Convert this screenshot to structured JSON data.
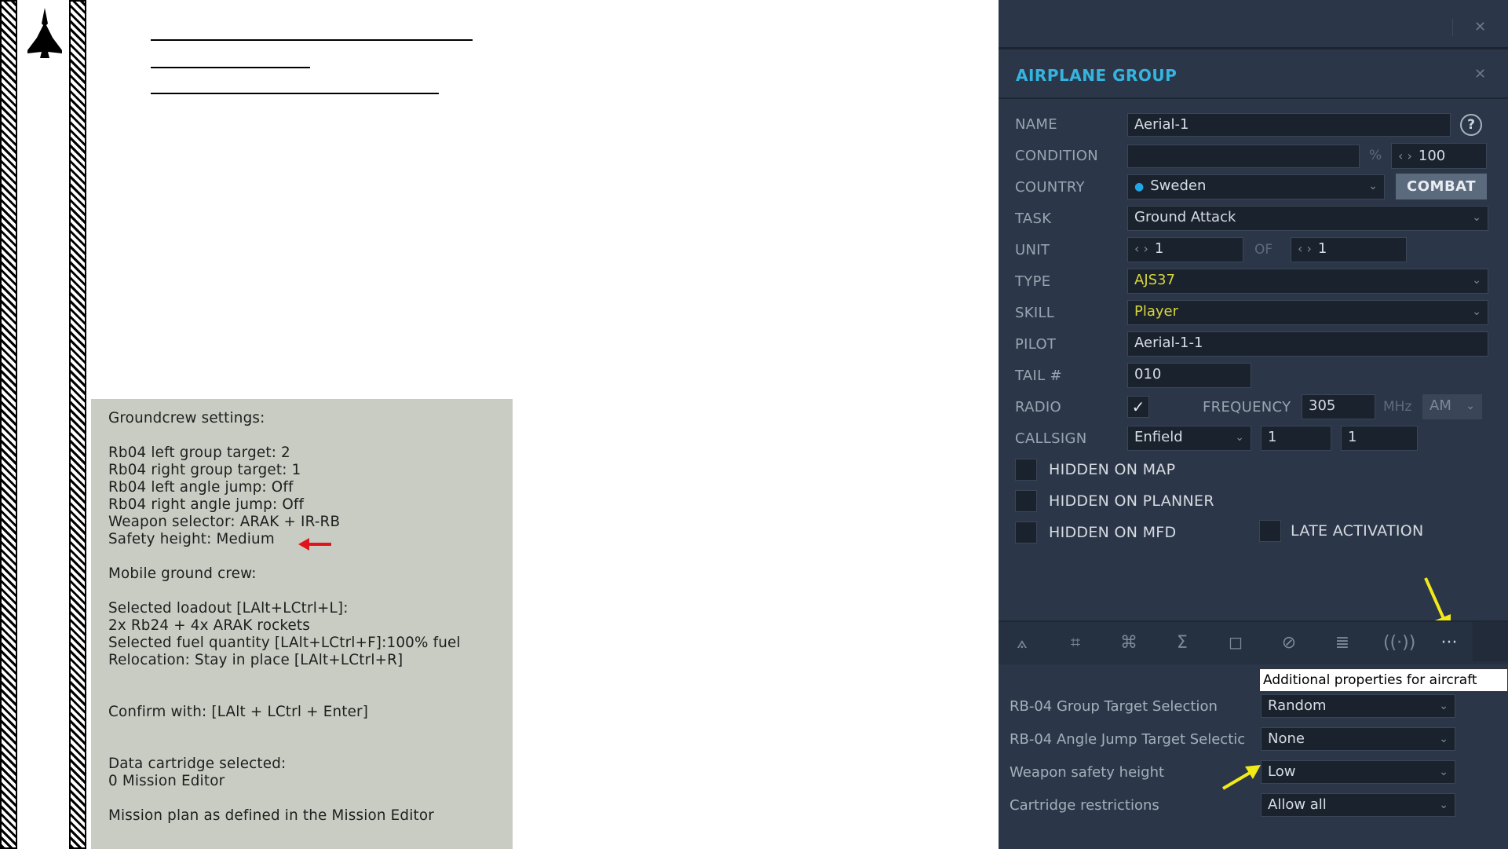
{
  "notes": {
    "lines": [
      "Groundcrew settings:",
      "",
      "Rb04 left group target: 2",
      "Rb04 right group target: 1",
      "Rb04 left angle jump: Off",
      "Rb04 right angle jump: Off",
      "Weapon selector: ARAK + IR-RB",
      "Safety height: Medium",
      "",
      "Mobile ground crew:",
      "",
      "Selected loadout [LAlt+LCtrl+L]:",
      "2x Rb24 + 4x ARAK rockets",
      "Selected fuel quantity [LAlt+LCtrl+F]:100% fuel",
      "Relocation: Stay in place [LAlt+LCtrl+R]",
      "",
      "",
      "Confirm with: [LAlt + LCtrl + Enter]",
      "",
      "",
      "Data cartridge selected:",
      "0 Mission Editor",
      "",
      "Mission plan as defined in the Mission Editor"
    ]
  },
  "panel": {
    "title": "AIRPLANE GROUP",
    "labels": {
      "name": "NAME",
      "condition": "CONDITION",
      "country": "COUNTRY",
      "task": "TASK",
      "unit": "UNIT",
      "type": "TYPE",
      "skill": "SKILL",
      "pilot": "PILOT",
      "tail": "TAIL #",
      "radio": "RADIO",
      "frequency": "FREQUENCY",
      "callsign": "CALLSIGN",
      "of": "OF",
      "percent": "%",
      "mhz": "MHz"
    },
    "values": {
      "name": "Aerial-1",
      "condition": "",
      "condition_value": "100",
      "country": "Sweden",
      "task": "Ground Attack",
      "unit": "1",
      "unit_of": "1",
      "type": "AJS37",
      "skill": "Player",
      "pilot": "Aerial-1-1",
      "tail": "010",
      "radio_checked": true,
      "frequency": "305",
      "modulation": "AM",
      "callsign": "Enfield",
      "callsign_num1": "1",
      "callsign_num2": "1"
    },
    "combat_label": "COMBAT",
    "help": "?",
    "checkboxes": {
      "hidden_map": "HIDDEN ON MAP",
      "hidden_planner": "HIDDEN ON PLANNER",
      "hidden_mfd": "HIDDEN ON MFD",
      "late_activation": "LATE ACTIVATION"
    },
    "tabs": {
      "more_label": "···"
    },
    "tooltip": "Additional properties for aircraft",
    "properties": [
      {
        "label": "RB-04 Group Target Selection",
        "value": "Random"
      },
      {
        "label": "RB-04 Angle Jump Target Selectic",
        "value": "None"
      },
      {
        "label": "Weapon safety height",
        "value": "Low"
      },
      {
        "label": "Cartridge restrictions",
        "value": "Allow all"
      }
    ]
  },
  "colors": {
    "panel_bg": "#2b3748",
    "title": "#36b4e0",
    "yellow_value": "#d8d63a",
    "note_bg": "#c9ccc3",
    "red_arrow": "#e0141a",
    "yellow_arrow": "#f2ea18"
  }
}
